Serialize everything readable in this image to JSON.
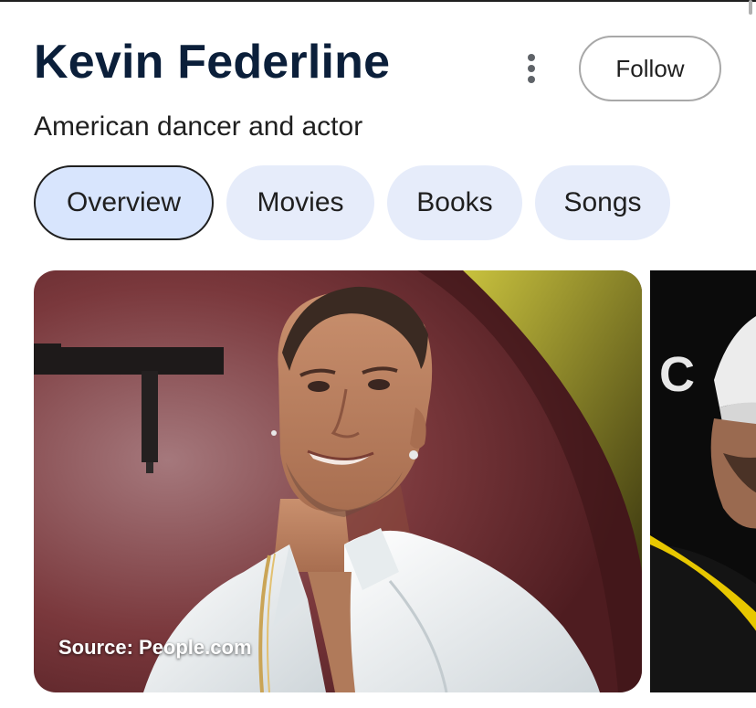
{
  "header": {
    "title": "Kevin Federline",
    "subtitle": "American dancer and actor",
    "follow_label": "Follow",
    "more_icon": "more-vert-icon"
  },
  "tabs": [
    {
      "label": "Overview",
      "active": true
    },
    {
      "label": "Movies",
      "active": false
    },
    {
      "label": "Books",
      "active": false
    },
    {
      "label": "Songs",
      "active": false
    }
  ],
  "images": {
    "main_source": "Source: People.com",
    "second_partial_text": "C"
  },
  "colors": {
    "title": "#0b1f3a",
    "tab_bg": "#e6ecfa",
    "tab_active_bg": "#d8e5fd",
    "photo_backdrop": "#6a2a2e",
    "shirt": "#eef1f3"
  }
}
